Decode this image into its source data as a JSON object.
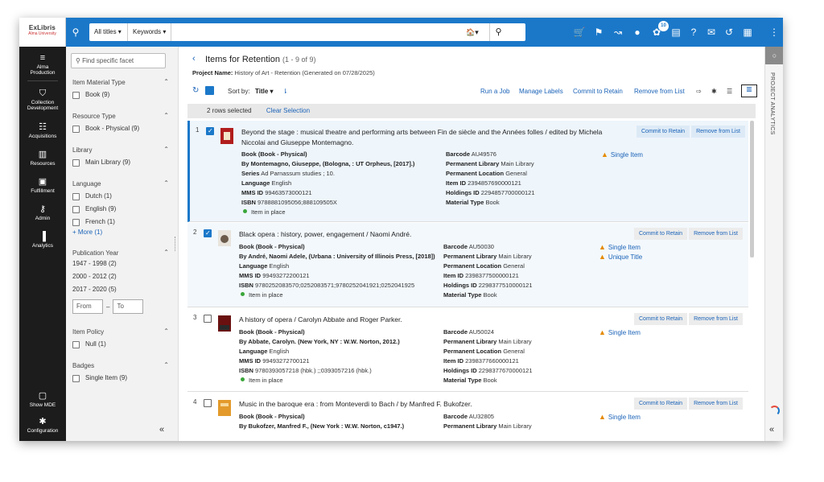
{
  "logo": {
    "line1": "ExLibris",
    "line2": "Alma University"
  },
  "search": {
    "scope": "All titles ▾",
    "field": "Keywords ▾",
    "placeholder": "",
    "home": "🏠▾"
  },
  "topbar": {
    "notifications": "10"
  },
  "nav": [
    {
      "label1": "Alma",
      "label2": "Production",
      "icon": "menu-icon"
    },
    {
      "label1": "Collection",
      "label2": "Development",
      "icon": "basket-icon"
    },
    {
      "label1": "Acquisitions",
      "label2": "",
      "icon": "receipt-icon"
    },
    {
      "label1": "Resources",
      "label2": "",
      "icon": "books-icon"
    },
    {
      "label1": "Fulfillment",
      "label2": "",
      "icon": "fulfillment-icon"
    },
    {
      "label1": "Admin",
      "label2": "",
      "icon": "wrench-icon"
    },
    {
      "label1": "Analytics",
      "label2": "",
      "icon": "chart-icon"
    },
    {
      "label1": "Show MDE",
      "label2": "",
      "icon": "mde-icon"
    },
    {
      "label1": "Configuration",
      "label2": "",
      "icon": "gear-icon"
    }
  ],
  "facets": {
    "search_placeholder": "Find specific facet",
    "material": {
      "title": "Item Material Type",
      "opts": [
        "Book (9)"
      ]
    },
    "resource": {
      "title": "Resource Type",
      "opts": [
        "Book - Physical (9)"
      ]
    },
    "library": {
      "title": "Library",
      "opts": [
        "Main Library (9)"
      ]
    },
    "language": {
      "title": "Language",
      "opts": [
        "Dutch (1)",
        "English (9)",
        "French (1)"
      ],
      "more": "+ More (1)"
    },
    "pubyear": {
      "title": "Publication Year",
      "opts": [
        "1947 - 1998 (2)",
        "2000 - 2012 (2)",
        "2017 - 2020 (5)"
      ],
      "from": "From",
      "dash": "–",
      "to": "To"
    },
    "policy": {
      "title": "Item Policy",
      "opts": [
        "Null (1)"
      ]
    },
    "badges": {
      "title": "Badges",
      "opts": [
        "Single Item (9)"
      ]
    }
  },
  "page": {
    "title": "Items for Retention",
    "count": "(1 - 9 of 9)",
    "project_label": "Project Name:",
    "project_value": "History of Art - Retention (Generated on 07/28/2025)"
  },
  "toolbar": {
    "sort_label": "Sort by:",
    "sort_value": "Title ▾",
    "run_job": "Run a Job",
    "manage_labels": "Manage Labels",
    "commit": "Commit to Retain",
    "remove": "Remove from List"
  },
  "selection": {
    "text": "2 rows selected",
    "clear": "Clear Selection"
  },
  "row_actions": {
    "commit": "Commit to Retain",
    "remove": "Remove from List"
  },
  "rows": [
    {
      "num": "1",
      "title": "Beyond the stage : musical theatre and performing arts between Fin de siècle and the Années folles / edited by Michela Niccolai and Giuseppe Montemagno.",
      "type": "Book (Book - Physical)",
      "by": "By Montemagno, Giuseppe, (Bologna, : UT Orpheus, [2017].)",
      "series_label": "Series",
      "series": "Ad Parnassum studies ; 10.",
      "lang": "English",
      "mms": "99463573000121",
      "isbn": "9788881095056;888109505X",
      "status": "Item in place",
      "barcode": "AU49576",
      "library": "Main Library",
      "location": "General",
      "item_id": "2394857690000121",
      "holdings_id": "2294857700000121",
      "material": "Book",
      "warnings": [
        "Single Item"
      ]
    },
    {
      "num": "2",
      "title": "Black opera : history, power, engagement / Naomi André.",
      "type": "Book (Book - Physical)",
      "by": "By André, Naomi Adele, (Urbana : University of Illinois Press, [2018])",
      "lang": "English",
      "mms": "99493272200121",
      "isbn": "9780252083570;0252083571;9780252041921;0252041925",
      "status": "Item in place",
      "barcode": "AU50030",
      "library": "Main Library",
      "location": "General",
      "item_id": "2398377500000121",
      "holdings_id": "2298377510000121",
      "material": "Book",
      "warnings": [
        "Single Item",
        "Unique Title"
      ]
    },
    {
      "num": "3",
      "title": "A history of opera / Carolyn Abbate and Roger Parker.",
      "type": "Book (Book - Physical)",
      "by": "By Abbate, Carolyn. (New York, NY : W.W. Norton, 2012.)",
      "lang": "English",
      "mms": "99493272700121",
      "isbn": "9780393057218 (hbk.) ;;0393057216 (hbk.)",
      "status": "Item in place",
      "barcode": "AU50024",
      "library": "Main Library",
      "location": "General",
      "item_id": "2398377660000121",
      "holdings_id": "2298377670000121",
      "material": "Book",
      "warnings": [
        "Single Item"
      ]
    },
    {
      "num": "4",
      "title": "Music in the baroque era : from Monteverdi to Bach / by Manfred F. Bukofzer.",
      "type": "Book (Book - Physical)",
      "by": "By Bukofzer, Manfred F., (New York : W.W. Norton, c1947.)",
      "barcode": "AU32805",
      "library": "Main Library",
      "warnings": [
        "Single Item"
      ]
    }
  ],
  "labels": {
    "lang": "Language",
    "mms": "MMS ID",
    "isbn": "ISBN",
    "barcode": "Barcode",
    "library": "Permanent Library",
    "location": "Permanent Location",
    "item_id": "Item ID",
    "holdings_id": "Holdings ID",
    "material": "Material Type"
  },
  "right_panel": {
    "label": "PROJECT ANALYTICS"
  },
  "colors": {
    "brand": "#1b78c9",
    "nav": "#1c1c1c",
    "warning": "#e58a00"
  }
}
